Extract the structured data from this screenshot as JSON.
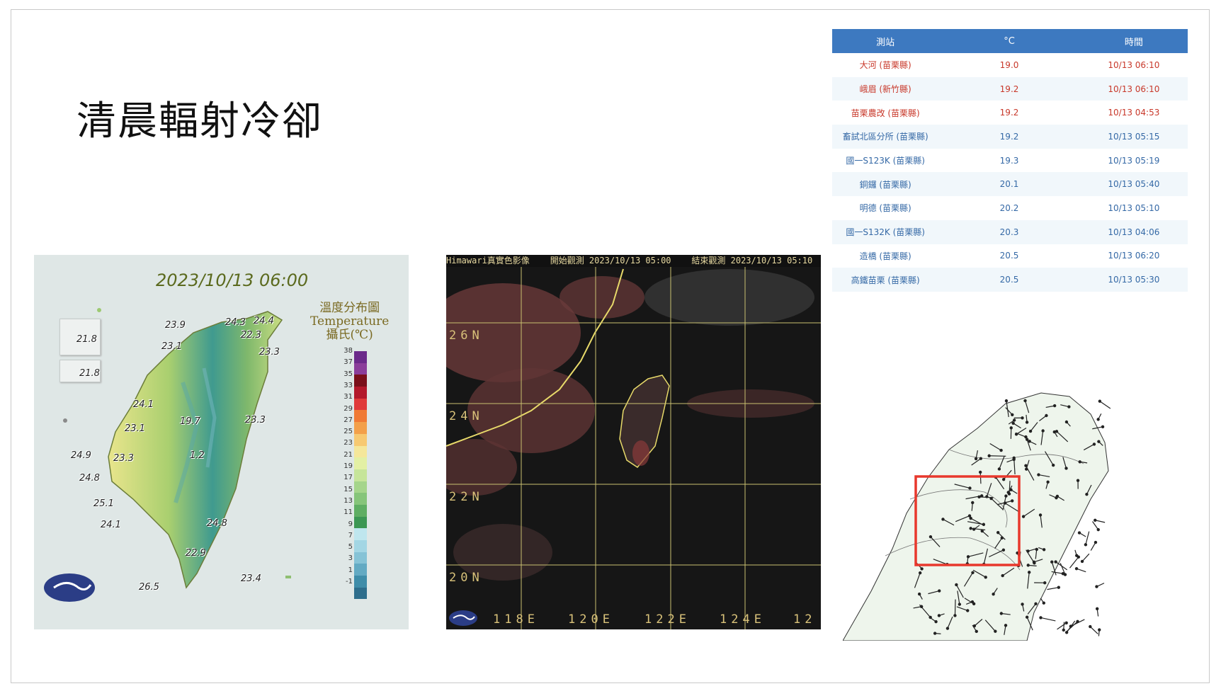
{
  "slide": {
    "title": "清晨輻射冷卻"
  },
  "temperature_map": {
    "date": "2023/10/13 06:00",
    "legend_title_line1": "溫度分布圖",
    "legend_title_line2": "Temperature",
    "legend_title_line3": "攝氏(℃)",
    "scale_ticks": [
      "38",
      "37",
      "35",
      "33",
      "31",
      "29",
      "27",
      "25",
      "23",
      "21",
      "19",
      "17",
      "15",
      "13",
      "11",
      "9",
      "7",
      "5",
      "3",
      "1",
      "-1"
    ],
    "scale_colors": [
      "#6b2a8a",
      "#8b3d9a",
      "#7a0f1a",
      "#b3182b",
      "#e03a3a",
      "#f07a35",
      "#f3a04a",
      "#f7c971",
      "#f5e79a",
      "#e3f0a4",
      "#c6e59a",
      "#a5d58b",
      "#86c57a",
      "#5fae63",
      "#3c9754",
      "#bfe6ee",
      "#a3d6e4",
      "#86c3d6",
      "#63aac3",
      "#3f8da9",
      "#2e6e8c"
    ],
    "stations": [
      {
        "label": "23.9"
      },
      {
        "label": "24.3"
      },
      {
        "label": "24.4"
      },
      {
        "label": "22.3"
      },
      {
        "label": "23.1"
      },
      {
        "label": "23.3"
      },
      {
        "label": "24.1"
      },
      {
        "label": "19.7"
      },
      {
        "label": "23.3"
      },
      {
        "label": "23.1"
      },
      {
        "label": "1.2"
      },
      {
        "label": "23.3"
      },
      {
        "label": "24.9"
      },
      {
        "label": "24.8"
      },
      {
        "label": "25.1"
      },
      {
        "label": "24.1"
      },
      {
        "label": "24.8"
      },
      {
        "label": "22.9"
      },
      {
        "label": "26.5"
      },
      {
        "label": "23.4"
      },
      {
        "label": "21.8"
      },
      {
        "label": "21.8"
      }
    ]
  },
  "satellite": {
    "header": "Himawari真實色影像    開始觀測 2023/10/13 05:00    結束觀測 2023/10/13 05:10",
    "lat_labels": [
      "26N",
      "24N",
      "22N",
      "20N"
    ],
    "lon_labels": [
      "118E",
      "120E",
      "122E",
      "124E",
      "12"
    ]
  },
  "station_table": {
    "headers": [
      "測站",
      "°C",
      "時間"
    ],
    "rows": [
      {
        "station": "大河 (苗栗縣)",
        "temp": "19.0",
        "time": "10/13 06:10",
        "color": "red"
      },
      {
        "station": "峨眉 (新竹縣)",
        "temp": "19.2",
        "time": "10/13 06:10",
        "color": "red"
      },
      {
        "station": "苗栗農改 (苗栗縣)",
        "temp": "19.2",
        "time": "10/13 04:53",
        "color": "red"
      },
      {
        "station": "畜試北區分所 (苗栗縣)",
        "temp": "19.2",
        "time": "10/13 05:15",
        "color": "blue"
      },
      {
        "station": "國一S123K (苗栗縣)",
        "temp": "19.3",
        "time": "10/13 05:19",
        "color": "blue"
      },
      {
        "station": "銅鑼 (苗栗縣)",
        "temp": "20.1",
        "time": "10/13 05:40",
        "color": "blue"
      },
      {
        "station": "明德 (苗栗縣)",
        "temp": "20.2",
        "time": "10/13 05:10",
        "color": "blue"
      },
      {
        "station": "國一S132K (苗栗縣)",
        "temp": "20.3",
        "time": "10/13 04:06",
        "color": "blue"
      },
      {
        "station": "造橋 (苗栗縣)",
        "temp": "20.5",
        "time": "10/13 06:20",
        "color": "blue"
      },
      {
        "station": "高鐵苗栗 (苗栗縣)",
        "temp": "20.5",
        "time": "10/13 05:30",
        "color": "blue"
      }
    ]
  },
  "colors": {
    "table_header": "#3d79c0",
    "highlight_box": "#e8382d",
    "land": "#eef5ec"
  }
}
